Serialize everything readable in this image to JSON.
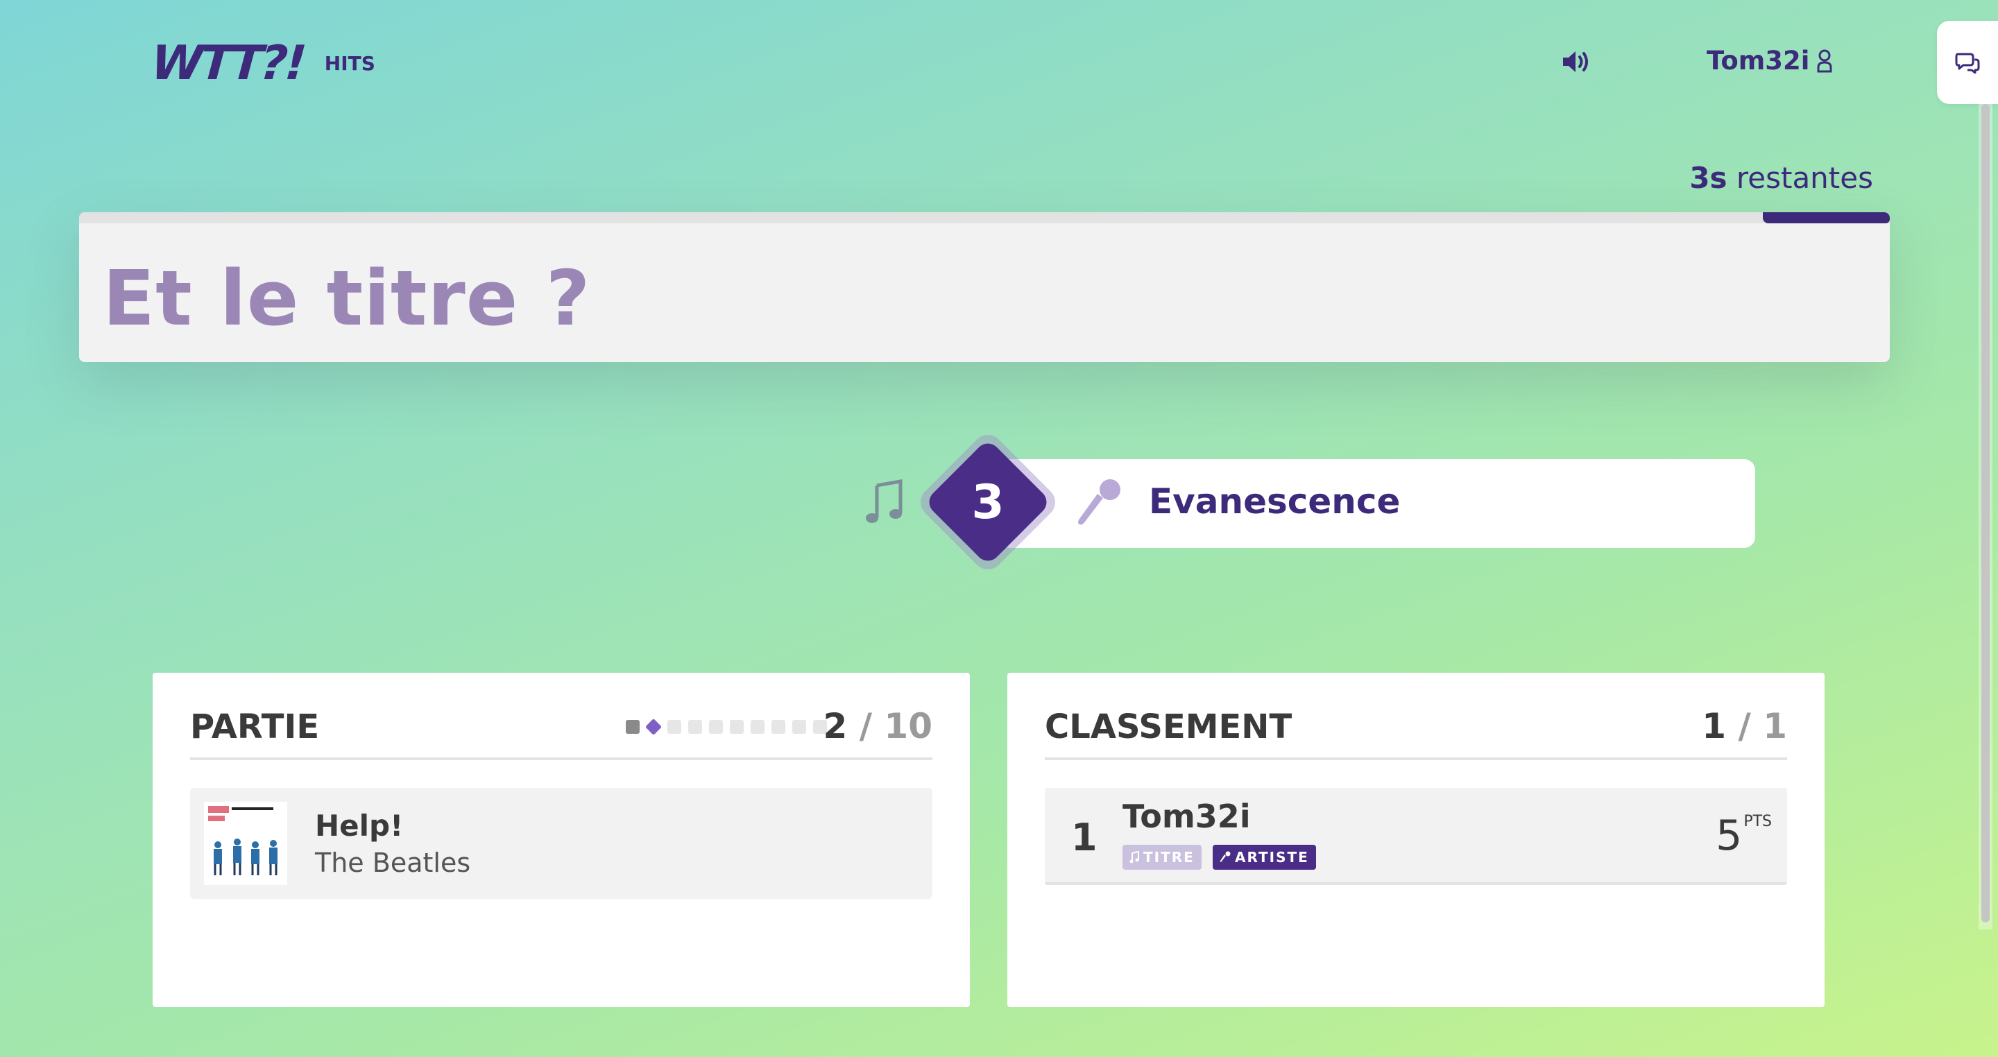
{
  "header": {
    "logo": "WTT?!",
    "mode": "HITS",
    "username": "Tom32i",
    "icons": {
      "sound": "speaker-volume-icon",
      "user": "user-icon",
      "chat": "chat-bubbles-icon"
    }
  },
  "timer": {
    "value": "3s",
    "suffix": " restantes",
    "remaining_fraction": 0.07
  },
  "question": {
    "text": "Et le titre ?"
  },
  "round": {
    "number": "3",
    "artist_answer": "Evanescence",
    "icons": {
      "title": "music-note-icon",
      "artist": "microphone-icon"
    }
  },
  "game_panel": {
    "title": "PARTIE",
    "current": "2",
    "separator": "/",
    "total": "10",
    "progress_states": [
      "done",
      "current",
      "pending",
      "pending",
      "pending",
      "pending",
      "pending",
      "pending",
      "pending",
      "pending"
    ],
    "last_song": {
      "title": "Help!",
      "artist": "The Beatles",
      "cover_icon": "album-cover-image"
    }
  },
  "ranking_panel": {
    "title": "CLASSEMENT",
    "current": "1",
    "separator": "/",
    "total": "1",
    "rows": [
      {
        "position": "1",
        "name": "Tom32i",
        "badge_title": "TITRE",
        "badge_artist": "ARTISTE",
        "title_found": false,
        "artist_found": true,
        "points": "5",
        "points_unit": "PTS"
      }
    ]
  },
  "colors": {
    "brand": "#3d2a7a",
    "accent": "#4a2d87",
    "question_text": "#9a87b6",
    "gradient_start": "#7fd6d6",
    "gradient_end": "#c8f38c"
  }
}
